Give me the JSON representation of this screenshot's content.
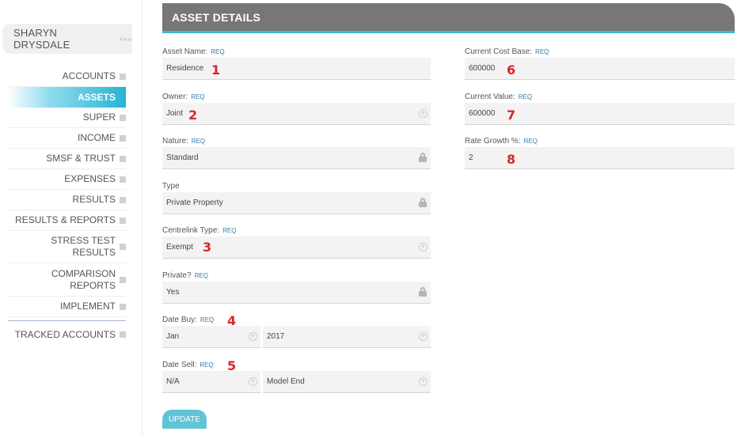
{
  "user": {
    "name": "SHARYN DRYSDALE",
    "dots": "»»»"
  },
  "nav": [
    {
      "label": "ACCOUNTS"
    },
    {
      "label": "ASSETS",
      "active": true
    },
    {
      "label": "SUPER"
    },
    {
      "label": "INCOME"
    },
    {
      "label": "SMSF & TRUST"
    },
    {
      "label": "EXPENSES"
    },
    {
      "label": "RESULTS"
    },
    {
      "label": "RESULTS & REPORTS"
    },
    {
      "label": "STRESS TEST RESULTS"
    },
    {
      "label": "COMPARISON REPORTS"
    },
    {
      "label": "IMPLEMENT"
    },
    {
      "label": "TRACKED ACCOUNTS"
    }
  ],
  "header": {
    "title": "ASSET DETAILS"
  },
  "req_label": "REQ",
  "fields": {
    "asset_name": {
      "label": "Asset Name:",
      "value": "Residence",
      "marker": "1"
    },
    "owner": {
      "label": "Owner:",
      "value": "Joint",
      "marker": "2"
    },
    "nature": {
      "label": "Nature:",
      "value": "Standard"
    },
    "type": {
      "label": "Type",
      "value": "Private Property"
    },
    "centrelink_type": {
      "label": "Centrelink Type:",
      "value": "Exempt",
      "marker": "3"
    },
    "private": {
      "label": "Private?",
      "value": "Yes"
    },
    "date_buy": {
      "label": "Date Buy:",
      "month": "Jan",
      "year": "2017",
      "marker": "4"
    },
    "date_sell": {
      "label": "Date Sell:",
      "month": "N/A",
      "year": "Model End",
      "marker": "5"
    },
    "current_cost_base": {
      "label": "Current Cost Base:",
      "value": "600000",
      "marker": "6"
    },
    "current_value": {
      "label": "Current Value:",
      "value": "600000",
      "marker": "7"
    },
    "rate_growth": {
      "label": "Rate Growth %:",
      "value": "2",
      "marker": "8"
    }
  },
  "update_button": "UPDATE",
  "icons": {
    "dropdown": "plus-circle-icon",
    "locked": "lock-icon",
    "nav_square": "square-icon"
  },
  "colors": {
    "accent": "#27b3d4",
    "header_bg": "#787676",
    "marker": "#d6262a",
    "req": "#2f7ea8",
    "button": "#62c3d6"
  }
}
